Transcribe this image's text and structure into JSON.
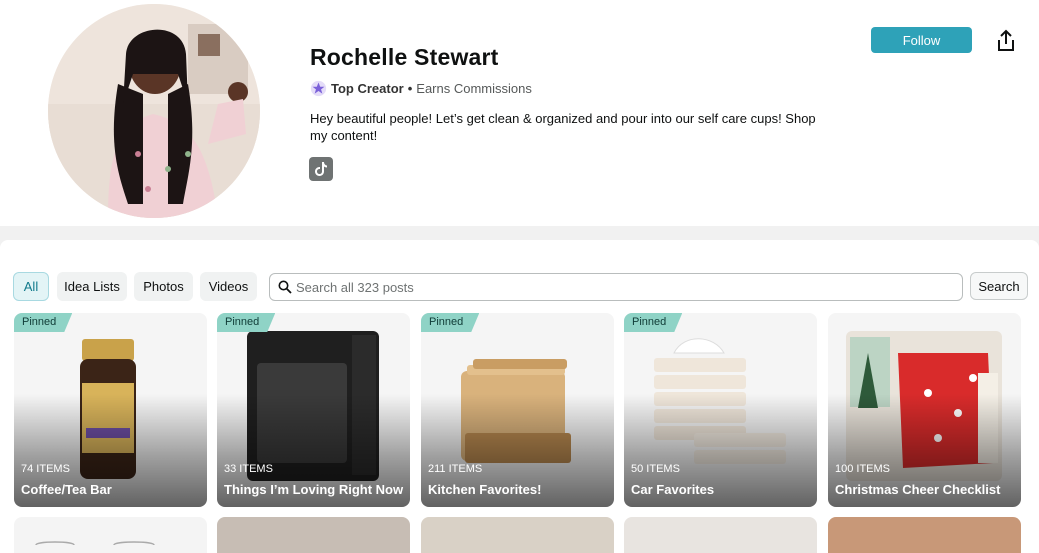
{
  "profile": {
    "name": "Rochelle Stewart",
    "badge": "Top Creator",
    "separator": "•",
    "earns": "Earns Commissions",
    "bio": "Hey beautiful people! Let’s get clean & organized and pour into our self care cups! Shop my content!",
    "social_icon": "tiktok-icon"
  },
  "actions": {
    "follow_label": "Follow",
    "share_icon": "share-icon"
  },
  "filters": {
    "tabs": [
      "All",
      "Idea Lists",
      "Photos",
      "Videos"
    ],
    "active": "All",
    "search_placeholder": "Search all 323 posts",
    "search_button": "Search"
  },
  "cards": [
    {
      "pinned": "Pinned",
      "count": "74 ITEMS",
      "title": "Coffee/Tea Bar"
    },
    {
      "pinned": "Pinned",
      "count": "33 ITEMS",
      "title": "Things I’m Loving Right Now"
    },
    {
      "pinned": "Pinned",
      "count": "211 ITEMS",
      "title": "Kitchen Favorites!"
    },
    {
      "pinned": "Pinned",
      "count": "50 ITEMS",
      "title": "Car Favorites"
    },
    {
      "pinned": "",
      "count": "100 ITEMS",
      "title": "Christmas Cheer Checklist"
    }
  ],
  "colors": {
    "accent": "#2ea2b8",
    "pinned": "#8fd3c6",
    "badge_star": "#7b61d9"
  }
}
